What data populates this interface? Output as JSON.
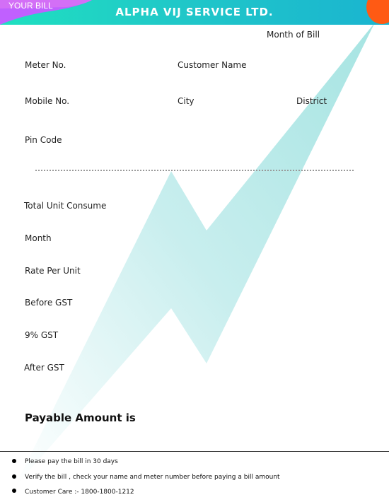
{
  "header": {
    "tag": "YOUR BILL",
    "company": "ALPHA VIJ SERVICE LTD."
  },
  "colors": {
    "header_start": "#1fe0c0",
    "header_end": "#1ab4d0",
    "tag_accent": "#c060ff",
    "corner_accent": "#ff5a14",
    "bolt": "#9ee3e0"
  },
  "customer": {
    "month_of_bill": "Month of Bill",
    "meter_no": "Meter No.",
    "customer_name": "Customer Name",
    "mobile_no": "Mobile No.",
    "city": "City",
    "district": "District",
    "pin_code": "Pin Code"
  },
  "billing": {
    "total_unit": "Total Unit Consume",
    "month": "Month",
    "rate": "Rate Per Unit",
    "before_gst": "Before GST",
    "gst": "9% GST",
    "after_gst": "After GST"
  },
  "payable": "Payable Amount is",
  "notes": [
    "Please pay the bill in 30 days",
    "Verify the bill , check your name and meter number before paying a bill amount",
    "Customer Care :- 1800-1800-1212"
  ]
}
